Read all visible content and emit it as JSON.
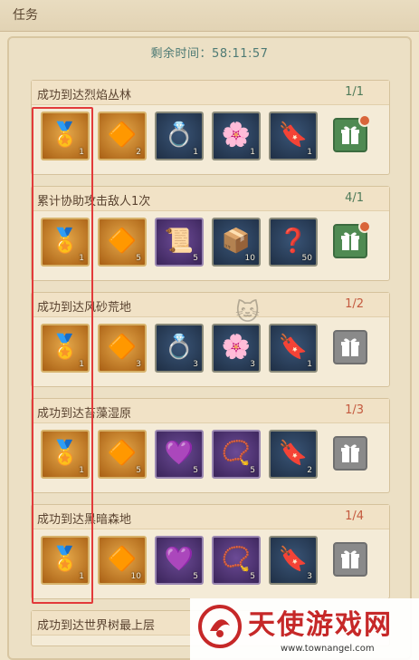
{
  "header": {
    "title": "任务"
  },
  "timer": {
    "text": "剩余时间：58:11:57"
  },
  "colors": {
    "accent": "#4d7a74",
    "done": "#4e7a59",
    "pending": "#c45a3f",
    "highlight": "#e23a3a"
  },
  "tasks": [
    {
      "name": "成功到达烈焰丛林",
      "progress": "1/1",
      "status": "done",
      "claimable": true,
      "rewards": [
        {
          "icon": "gold-medal-icon",
          "qty": "1"
        },
        {
          "icon": "red-gold-shards-icon",
          "qty": "2"
        },
        {
          "icon": "gold-ring-icon",
          "qty": "1"
        },
        {
          "icon": "flower-wreath-icon",
          "qty": "1"
        },
        {
          "icon": "copper-token-icon",
          "qty": "1"
        }
      ]
    },
    {
      "name": "累计协助攻击敌人1次",
      "progress": "4/1",
      "status": "done",
      "claimable": true,
      "rewards": [
        {
          "icon": "gold-medal-icon",
          "qty": "1"
        },
        {
          "icon": "red-gold-shards-icon",
          "qty": "5"
        },
        {
          "icon": "papers-icon",
          "qty": "5"
        },
        {
          "icon": "parcel-icon",
          "qty": "10"
        },
        {
          "icon": "mystery-box-icon",
          "qty": "50"
        }
      ]
    },
    {
      "name": "成功到达风砂荒地",
      "progress": "1/2",
      "status": "pending",
      "claimable": false,
      "rewards": [
        {
          "icon": "gold-medal-icon",
          "qty": "1"
        },
        {
          "icon": "red-gold-shards-icon",
          "qty": "3"
        },
        {
          "icon": "gold-ring-icon",
          "qty": "3"
        },
        {
          "icon": "flower-wreath-icon",
          "qty": "3"
        },
        {
          "icon": "copper-token-icon",
          "qty": "1"
        }
      ]
    },
    {
      "name": "成功到达苔藻湿原",
      "progress": "1/3",
      "status": "pending",
      "claimable": false,
      "rewards": [
        {
          "icon": "gold-medal-icon",
          "qty": "1"
        },
        {
          "icon": "red-gold-shards-icon",
          "qty": "5"
        },
        {
          "icon": "amethyst-ring-icon",
          "qty": "5"
        },
        {
          "icon": "pearl-necklace-icon",
          "qty": "5"
        },
        {
          "icon": "copper-token-icon",
          "qty": "2"
        }
      ]
    },
    {
      "name": "成功到达黑暗森地",
      "progress": "1/4",
      "status": "pending",
      "claimable": false,
      "rewards": [
        {
          "icon": "gold-medal-icon",
          "qty": "1"
        },
        {
          "icon": "red-gold-shards-icon",
          "qty": "10"
        },
        {
          "icon": "amethyst-ring-icon",
          "qty": "5"
        },
        {
          "icon": "pearl-necklace-icon",
          "qty": "5"
        },
        {
          "icon": "copper-token-icon",
          "qty": "3"
        }
      ]
    },
    {
      "name": "成功到达世界树最上层",
      "progress": "",
      "status": "pending",
      "claimable": false,
      "rewards": []
    }
  ],
  "watermark": {
    "text": "天使游戏网",
    "url": "www.townangel.com"
  }
}
